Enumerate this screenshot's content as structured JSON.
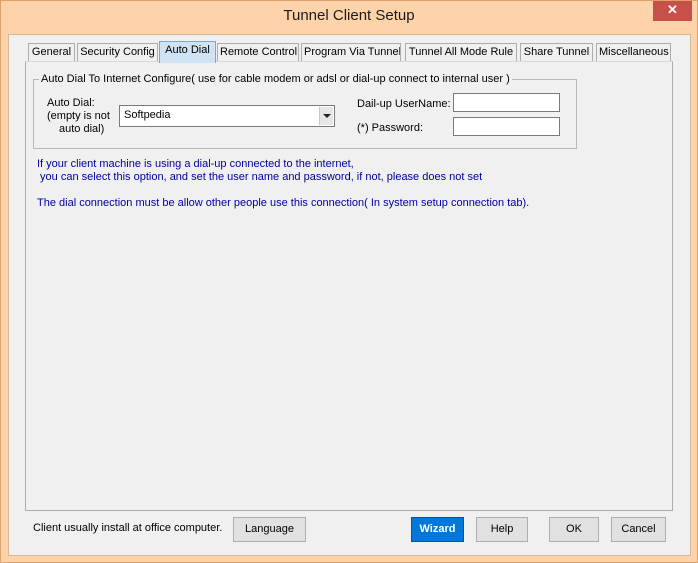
{
  "window": {
    "title": "Tunnel Client Setup",
    "close_glyph": "✕",
    "title_bar_color": "#ffd3a9",
    "close_button_color": "#c7504b"
  },
  "tabs": [
    {
      "label": "General"
    },
    {
      "label": "Security Config"
    },
    {
      "label": "Auto Dial",
      "active": true
    },
    {
      "label": "Remote Control"
    },
    {
      "label": "Program Via Tunnel"
    },
    {
      "label": "Tunnel All Mode Rule"
    },
    {
      "label": "Share Tunnel"
    },
    {
      "label": "Miscellaneous"
    }
  ],
  "auto_dial": {
    "group_title": "Auto Dial To Internet Configure( use for cable modem or adsl or dial-up connect to internal user )",
    "auto_dial_label_1": "Auto Dial:",
    "auto_dial_label_2": "(empty is not",
    "auto_dial_label_3": "auto dial)",
    "combo_value": "Softpedia",
    "username_label": "Dail-up UserName:",
    "username_value": "",
    "password_label": "(*) Password:",
    "password_value": ""
  },
  "info": {
    "line1": "If your client machine is using a dial-up connected to the internet,",
    "line2": " you can select this option, and set the user name and password, if not, please does not set",
    "line3": "The dial connection must be allow other people use this connection( In system setup connection tab).",
    "text_color": "#0000a0"
  },
  "footer": {
    "note": "Client usually install at office computer.",
    "language_label": "Language",
    "wizard_label": "Wizard",
    "help_label": "Help",
    "ok_label": "OK",
    "cancel_label": "Cancel",
    "accent": "#0078d7"
  }
}
